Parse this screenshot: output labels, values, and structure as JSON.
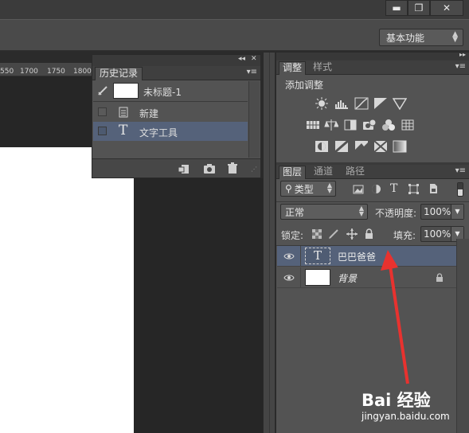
{
  "window_controls": {
    "minimize": "▬",
    "restore": "❐",
    "close": "✕"
  },
  "options_bar": {
    "workspace": "基本功能"
  },
  "ruler": {
    "ticks": [
      "550",
      "1700",
      "1750",
      "1800"
    ]
  },
  "history": {
    "tab": "历史记录",
    "snapshot_name": "未标题-1",
    "items": [
      {
        "label": "新建",
        "icon": "new-document-icon"
      },
      {
        "label": "文字工具",
        "icon": "type-tool-icon"
      }
    ],
    "footer_icons": [
      "new-document-from-state-icon",
      "camera-icon",
      "trash-icon"
    ]
  },
  "adjustments": {
    "tabs": [
      "调整",
      "样式"
    ],
    "heading": "添加调整"
  },
  "layers": {
    "tabs": [
      "图层",
      "通道",
      "路径"
    ],
    "filter_kind": "类型",
    "blend_mode": "正常",
    "opacity_label": "不透明度:",
    "opacity_value": "100%",
    "lock_label": "锁定:",
    "fill_label": "填充:",
    "fill_value": "100%",
    "items": [
      {
        "name": "巴巴爸爸",
        "type": "text"
      },
      {
        "name": "背景",
        "type": "background"
      }
    ]
  },
  "watermark": {
    "logo": "Bai 经验",
    "url": "jingyan.baidu.com"
  },
  "colors": {
    "selection": "#55627a",
    "panel": "#535353",
    "accent_arrow": "#e8322f"
  }
}
